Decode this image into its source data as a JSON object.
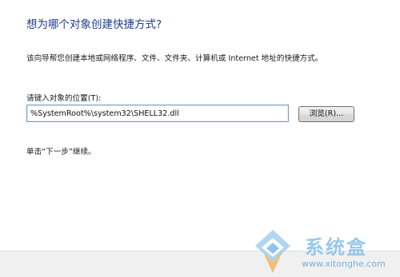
{
  "wizard": {
    "heading": "想为哪个对象创建快捷方式?",
    "description": "该向导帮您创建本地或网络程序、文件、文件夹、计算机或 Internet 地址的快捷方式。",
    "location_label": "请键入对象的位置(T):",
    "location_value": "%SystemRoot%\\system32\\SHELL32.dll",
    "browse_label": "浏览(R)...",
    "next_hint": "单击“下一步”继续。"
  },
  "watermark": {
    "title": "系统盒",
    "url": "www.xitonghe.com"
  },
  "colors": {
    "heading": "#1e3c8c",
    "input_border": "#7a9bc7",
    "footer": "#f0f0f0",
    "watermark": "#8fc3ea"
  }
}
